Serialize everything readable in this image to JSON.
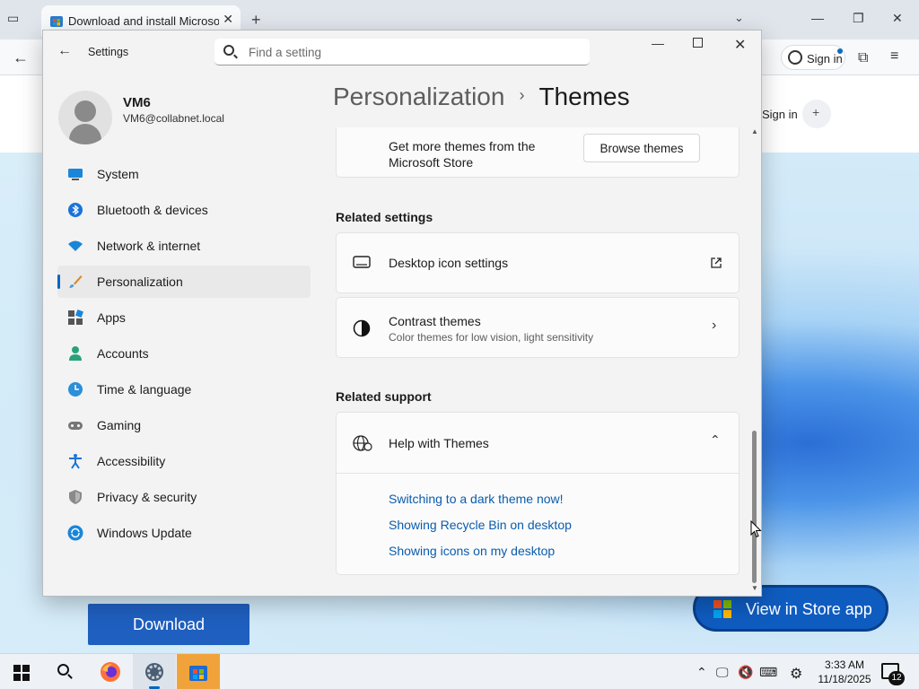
{
  "browser": {
    "tab_title": "Download and install Microsoft",
    "signin_label": "Sign in",
    "page_signin_label": "Sign in",
    "download_label": "Download",
    "store_button_label": "View in Store app"
  },
  "settings": {
    "app_title": "Settings",
    "search_placeholder": "Find a setting",
    "profile": {
      "name": "VM6",
      "email": "VM6@collabnet.local"
    },
    "nav": [
      {
        "label": "System",
        "icon": "monitor-icon"
      },
      {
        "label": "Bluetooth & devices",
        "icon": "bluetooth-icon"
      },
      {
        "label": "Network & internet",
        "icon": "wifi-icon"
      },
      {
        "label": "Personalization",
        "icon": "brush-icon",
        "active": true
      },
      {
        "label": "Apps",
        "icon": "apps-icon"
      },
      {
        "label": "Accounts",
        "icon": "person-icon"
      },
      {
        "label": "Time & language",
        "icon": "globe-clock-icon"
      },
      {
        "label": "Gaming",
        "icon": "gamepad-icon"
      },
      {
        "label": "Accessibility",
        "icon": "accessibility-icon"
      },
      {
        "label": "Privacy & security",
        "icon": "shield-icon"
      },
      {
        "label": "Windows Update",
        "icon": "update-icon"
      }
    ],
    "breadcrumb": {
      "parent": "Personalization",
      "separator": "›",
      "current": "Themes"
    },
    "store_card": {
      "text": "Get more themes from the Microsoft Store",
      "button": "Browse themes"
    },
    "related_settings_heading": "Related settings",
    "desktop_icon_settings": "Desktop icon settings",
    "contrast_themes": {
      "title": "Contrast themes",
      "subtitle": "Color themes for low vision, light sensitivity"
    },
    "related_support_heading": "Related support",
    "help": {
      "title": "Help with Themes",
      "links": [
        "Switching to a dark theme now!",
        "Showing Recycle Bin on desktop",
        "Showing icons on my desktop"
      ]
    }
  },
  "taskbar": {
    "time": "3:33 AM",
    "date": "11/18/2025",
    "notification_count": "12"
  },
  "colors": {
    "accent": "#0067c0",
    "link": "#0b5cad",
    "store_button": "#0f5cc0",
    "download_button": "#1f5fbf",
    "taskbar_highlight": "#f0a33a"
  }
}
